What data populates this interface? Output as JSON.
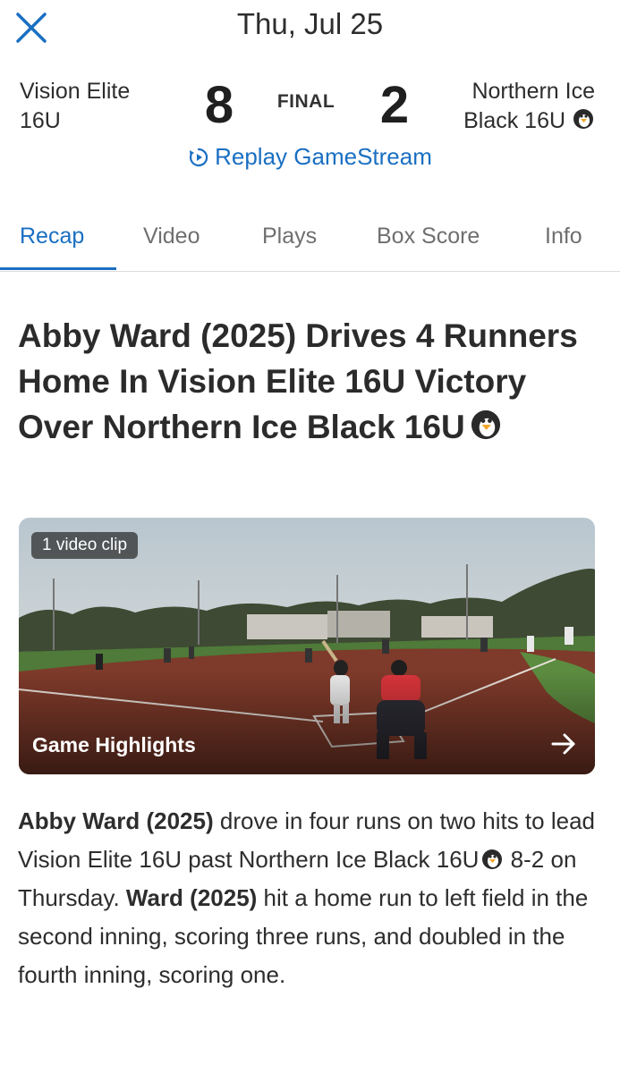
{
  "header": {
    "date": "Thu, Jul 25",
    "close_icon": "close-icon"
  },
  "game": {
    "home_team_line1": "Vision Elite",
    "home_team_line2": "16U",
    "home_score": "8",
    "status": "FINAL",
    "away_score": "2",
    "away_team_line1": "Northern Ice",
    "away_team_line2": "Black 16U",
    "away_team_emoji": "penguin-emoji-icon",
    "replay_label": "Replay GameStream",
    "replay_icon": "replay-icon"
  },
  "tabs": [
    {
      "label": "Recap",
      "active": true
    },
    {
      "label": "Video",
      "active": false
    },
    {
      "label": "Plays",
      "active": false
    },
    {
      "label": "Box Score",
      "active": false
    },
    {
      "label": "Info",
      "active": false
    }
  ],
  "recap": {
    "headline": "Abby Ward (2025) Drives 4 Runners Home In Vision Elite 16U Victory Over Northern Ice Black 16U",
    "video_card": {
      "badge": "1 video clip",
      "title": "Game Highlights",
      "arrow_icon": "arrow-right-icon"
    },
    "body": {
      "bold1": "Abby Ward (2025)",
      "text1": " drove in four runs on two hits to lead Vision Elite 16U past Northern Ice Black 16U",
      "text2": " 8-2 on Thursday. ",
      "bold2": "Ward (2025)",
      "text3": " hit a home run to left field in the second inning, scoring three runs, and doubled in the fourth inning, scoring one."
    }
  },
  "colors": {
    "accent": "#1a6fc2",
    "text": "#2b2b2b",
    "tab_inactive": "#6f6f6f"
  }
}
